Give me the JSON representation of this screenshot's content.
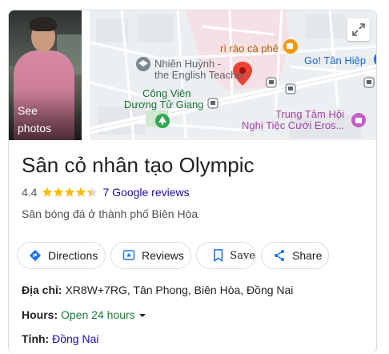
{
  "photo": {
    "see_photos": "See\nphotos"
  },
  "map": {
    "labels": {
      "cafe": "rì rào cà phê",
      "english_1": "Nhiên Huỳnh -",
      "english_2": "the English Teacher",
      "park_1": "Công Viên",
      "park_2": "Dương Tử Giang",
      "tanhiep": "Go! Tân Hiệp",
      "hoi_1": "Trung Tâm Hội",
      "hoi_2": "Nghị Tiệc Cưới Eros..."
    }
  },
  "place": {
    "name": "Sân cỏ nhân tạo Olympic",
    "rating": "4.4",
    "stars": 4.4,
    "reviews": "7 Google reviews",
    "category": "Sân bóng đá ở thành phố Biên Hòa"
  },
  "actions": {
    "directions": "Directions",
    "reviews": "Reviews",
    "save": "Save",
    "share": "Share"
  },
  "details": {
    "address_label": "Địa chỉ:",
    "address_value": "XR8W+7RG, Tân Phong, Biên Hòa, Đồng Nai",
    "hours_label": "Hours:",
    "hours_value": "Open 24 hours",
    "province_label": "Tỉnh:",
    "province_value": "Đồng Nai"
  },
  "colors": {
    "accent_blue": "#1a73e8",
    "star": "#fbbc04",
    "open_green": "#188038",
    "pin_red": "#ea4335"
  }
}
